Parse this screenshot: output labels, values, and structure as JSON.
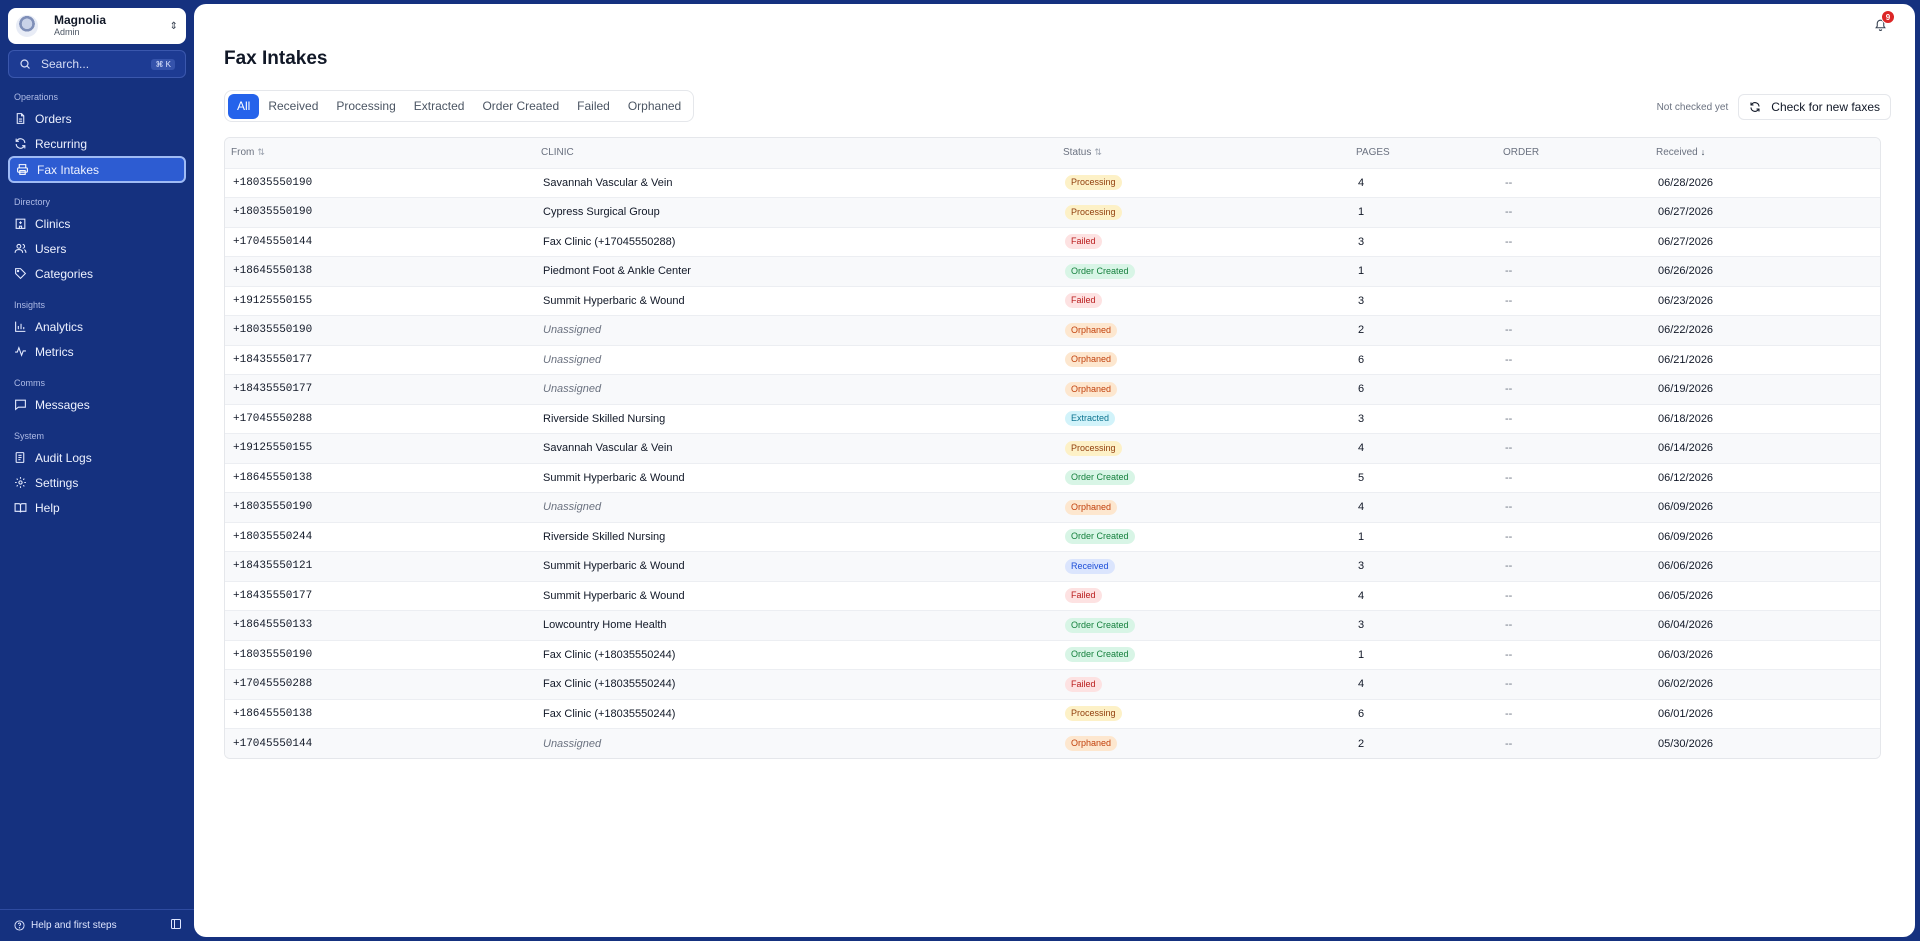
{
  "org": {
    "name": "Magnolia",
    "role": "Admin"
  },
  "search": {
    "placeholder": "Search...",
    "shortcut": "⌘ K"
  },
  "nav": {
    "operations": {
      "label": "Operations",
      "items": [
        "Orders",
        "Recurring",
        "Fax Intakes"
      ]
    },
    "directory": {
      "label": "Directory",
      "items": [
        "Clinics",
        "Users",
        "Categories"
      ]
    },
    "insights": {
      "label": "Insights",
      "items": [
        "Analytics",
        "Metrics"
      ]
    },
    "comms": {
      "label": "Comms",
      "items": [
        "Messages"
      ]
    },
    "system": {
      "label": "System",
      "items": [
        "Audit Logs",
        "Settings",
        "Help"
      ]
    },
    "active": "Fax Intakes"
  },
  "footer": {
    "help": "Help and first steps"
  },
  "notifications": {
    "count": "9"
  },
  "page": {
    "title": "Fax Intakes"
  },
  "tabs": [
    "All",
    "Received",
    "Processing",
    "Extracted",
    "Order Created",
    "Failed",
    "Orphaned"
  ],
  "active_tab": "All",
  "check": {
    "status": "Not checked yet",
    "button": "Check for new faxes"
  },
  "columns": {
    "from": "From",
    "clinic": "CLINIC",
    "status": "Status",
    "pages": "PAGES",
    "order": "ORDER",
    "received": "Received"
  },
  "rows": [
    {
      "from": "+18035550190",
      "clinic": "Savannah Vascular & Vein",
      "status": "Processing",
      "pages": "4",
      "order": "--",
      "received": "06/28/2026"
    },
    {
      "from": "+18035550190",
      "clinic": "Cypress Surgical Group",
      "status": "Processing",
      "pages": "1",
      "order": "--",
      "received": "06/27/2026"
    },
    {
      "from": "+17045550144",
      "clinic": "Fax Clinic (+17045550288)",
      "status": "Failed",
      "pages": "3",
      "order": "--",
      "received": "06/27/2026"
    },
    {
      "from": "+18645550138",
      "clinic": "Piedmont Foot & Ankle Center",
      "status": "Order Created",
      "pages": "1",
      "order": "--",
      "received": "06/26/2026"
    },
    {
      "from": "+19125550155",
      "clinic": "Summit Hyperbaric & Wound",
      "status": "Failed",
      "pages": "3",
      "order": "--",
      "received": "06/23/2026"
    },
    {
      "from": "+18035550190",
      "clinic": "Unassigned",
      "status": "Orphaned",
      "pages": "2",
      "order": "--",
      "received": "06/22/2026"
    },
    {
      "from": "+18435550177",
      "clinic": "Unassigned",
      "status": "Orphaned",
      "pages": "6",
      "order": "--",
      "received": "06/21/2026"
    },
    {
      "from": "+18435550177",
      "clinic": "Unassigned",
      "status": "Orphaned",
      "pages": "6",
      "order": "--",
      "received": "06/19/2026"
    },
    {
      "from": "+17045550288",
      "clinic": "Riverside Skilled Nursing",
      "status": "Extracted",
      "pages": "3",
      "order": "--",
      "received": "06/18/2026"
    },
    {
      "from": "+19125550155",
      "clinic": "Savannah Vascular & Vein",
      "status": "Processing",
      "pages": "4",
      "order": "--",
      "received": "06/14/2026"
    },
    {
      "from": "+18645550138",
      "clinic": "Summit Hyperbaric & Wound",
      "status": "Order Created",
      "pages": "5",
      "order": "--",
      "received": "06/12/2026"
    },
    {
      "from": "+18035550190",
      "clinic": "Unassigned",
      "status": "Orphaned",
      "pages": "4",
      "order": "--",
      "received": "06/09/2026"
    },
    {
      "from": "+18035550244",
      "clinic": "Riverside Skilled Nursing",
      "status": "Order Created",
      "pages": "1",
      "order": "--",
      "received": "06/09/2026"
    },
    {
      "from": "+18435550121",
      "clinic": "Summit Hyperbaric & Wound",
      "status": "Received",
      "pages": "3",
      "order": "--",
      "received": "06/06/2026"
    },
    {
      "from": "+18435550177",
      "clinic": "Summit Hyperbaric & Wound",
      "status": "Failed",
      "pages": "4",
      "order": "--",
      "received": "06/05/2026"
    },
    {
      "from": "+18645550133",
      "clinic": "Lowcountry Home Health",
      "status": "Order Created",
      "pages": "3",
      "order": "--",
      "received": "06/04/2026"
    },
    {
      "from": "+18035550190",
      "clinic": "Fax Clinic (+18035550244)",
      "status": "Order Created",
      "pages": "1",
      "order": "--",
      "received": "06/03/2026"
    },
    {
      "from": "+17045550288",
      "clinic": "Fax Clinic (+18035550244)",
      "status": "Failed",
      "pages": "4",
      "order": "--",
      "received": "06/02/2026"
    },
    {
      "from": "+18645550138",
      "clinic": "Fax Clinic (+18035550244)",
      "status": "Processing",
      "pages": "6",
      "order": "--",
      "received": "06/01/2026"
    },
    {
      "from": "+17045550144",
      "clinic": "Unassigned",
      "status": "Orphaned",
      "pages": "2",
      "order": "--",
      "received": "05/30/2026"
    }
  ],
  "colors": {
    "sidebar": "#15317f",
    "accent": "#2563eb",
    "badge": "#dc2626"
  }
}
